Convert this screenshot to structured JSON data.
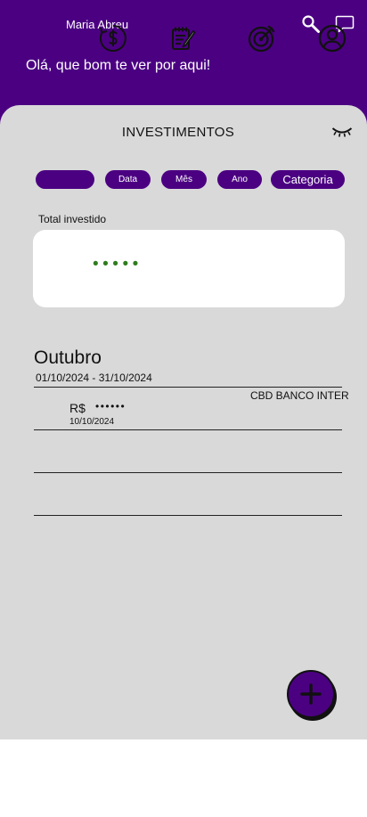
{
  "header": {
    "user_name": "Maria Abreu",
    "greeting": "Olá, que bom te ver por aqui!",
    "icons": [
      "search-icon",
      "chat-bubble-icon"
    ]
  },
  "section": {
    "title": "INVESTIMENTOS",
    "visibility_icon": "eye-closed-icon"
  },
  "filters": {
    "blank": "",
    "date": "Data",
    "month": "Mês",
    "year": "Ano",
    "category": "Categoria"
  },
  "total": {
    "label": "Total investido",
    "masked_value": "•••••"
  },
  "period": {
    "month": "Outubro",
    "range": "01/10/2024 - 31/10/2024"
  },
  "entries": [
    {
      "bank": "CBD  BANCO INTER",
      "currency": "R$",
      "masked_amount": "••••••",
      "date": "10/10/2024"
    }
  ],
  "fab_icon": "plus-icon",
  "bottom_nav": [
    "money-cycle-icon",
    "notepad-icon",
    "target-icon",
    "profile-icon"
  ],
  "colors": {
    "primary": "#4b0082",
    "background": "#d9d9d9",
    "masked_total": "#2f7d1e"
  }
}
